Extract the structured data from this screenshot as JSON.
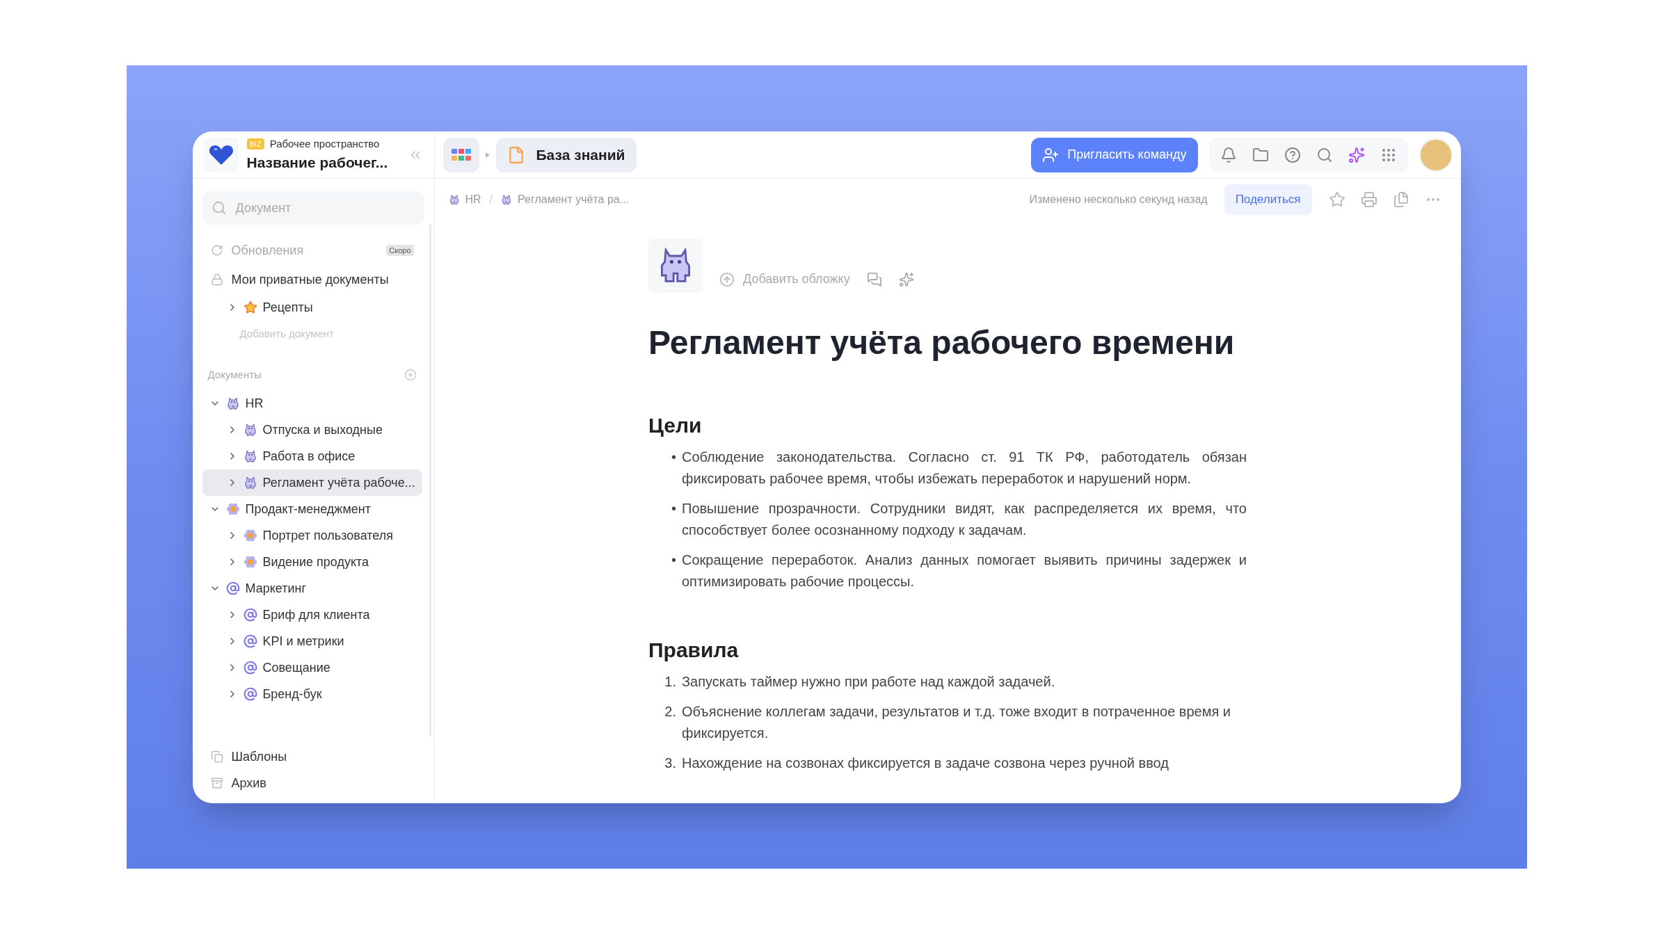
{
  "workspace": {
    "badge": "BIZ",
    "label": "Рабочее пространство",
    "name": "Название рабочег..."
  },
  "search": {
    "placeholder": "Документ"
  },
  "nav": [
    {
      "kind": "updates",
      "label": "Обновления",
      "badge": "Скоро",
      "disabled": true
    },
    {
      "kind": "private",
      "label": "Мои приватные документы",
      "disabled": false
    }
  ],
  "private_docs": [
    {
      "label": "Рецепты",
      "kind": "star",
      "expanded": false,
      "selected": false
    }
  ],
  "add_document": "Добавить документ",
  "documents_header": "Документы",
  "tree": [
    {
      "label": "HR",
      "kind": "cat",
      "expanded": true,
      "selected": false,
      "children": [
        {
          "label": "Отпуска и выходные",
          "kind": "cat",
          "expanded": false,
          "selected": false
        },
        {
          "label": "Работа в офисе",
          "kind": "cat",
          "expanded": false,
          "selected": false
        },
        {
          "label": "Регламент учёта рабоче...",
          "kind": "cat",
          "expanded": false,
          "selected": true
        }
      ]
    },
    {
      "label": "Продакт-менеджмент",
      "kind": "flower",
      "expanded": true,
      "selected": false,
      "children": [
        {
          "label": "Портрет пользователя",
          "kind": "flower",
          "expanded": false,
          "selected": false
        },
        {
          "label": "Видение продукта",
          "kind": "flower",
          "expanded": false,
          "selected": false
        }
      ]
    },
    {
      "label": "Маркетинг",
      "kind": "at",
      "expanded": true,
      "selected": false,
      "children": [
        {
          "label": "Бриф для клиента",
          "kind": "at",
          "expanded": false,
          "selected": false
        },
        {
          "label": "KPI и метрики",
          "kind": "at",
          "expanded": false,
          "selected": false
        },
        {
          "label": "Совещание",
          "kind": "at",
          "expanded": false,
          "selected": false
        },
        {
          "label": "Бренд-бук",
          "kind": "at",
          "expanded": false,
          "selected": false
        }
      ]
    }
  ],
  "footer": [
    {
      "kind": "templates",
      "label": "Шаблоны"
    },
    {
      "kind": "archive",
      "label": "Архив"
    }
  ],
  "topbar": {
    "section": "База знаний",
    "invite": "Пригласить команду"
  },
  "breadcrumbs": {
    "separator": "/",
    "items": [
      {
        "label": "HR"
      },
      {
        "label": "Регламент учёта ра..."
      }
    ]
  },
  "status": "Изменено несколько секунд назад",
  "share": "Поделиться",
  "doc": {
    "add_cover": "Добавить обложку",
    "title": "Регламент учёта рабочего времени",
    "sections": [
      {
        "heading": "Цели",
        "kind": "bullets",
        "items": [
          {
            "marker": "•",
            "text": "Соблюдение законодательства. Согласно ст. 91 ТК РФ, работодатель обязан фиксировать рабочее время, чтобы избежать переработок и нарушений норм."
          },
          {
            "marker": "•",
            "text": "Повышение прозрачности. Сотрудники видят, как распределяется их время, что способствует более осознанному подходу к задачам."
          },
          {
            "marker": "•",
            "text": "Сокращение переработок. Анализ данных помогает выявить причины задержек и оптимизировать рабочие процессы."
          }
        ]
      },
      {
        "heading": "Правила",
        "kind": "numbered",
        "items": [
          {
            "marker": "1.",
            "text": "Запускать таймер нужно при работе над каждой задачей."
          },
          {
            "marker": "2.",
            "text": "Объяснение коллегам задачи, результатов и т.д. тоже входит в потраченное время и фиксируется."
          },
          {
            "marker": "3.",
            "text": "Нахождение на созвонах фиксируется в задаче созвона через ручной ввод"
          }
        ]
      }
    ]
  }
}
